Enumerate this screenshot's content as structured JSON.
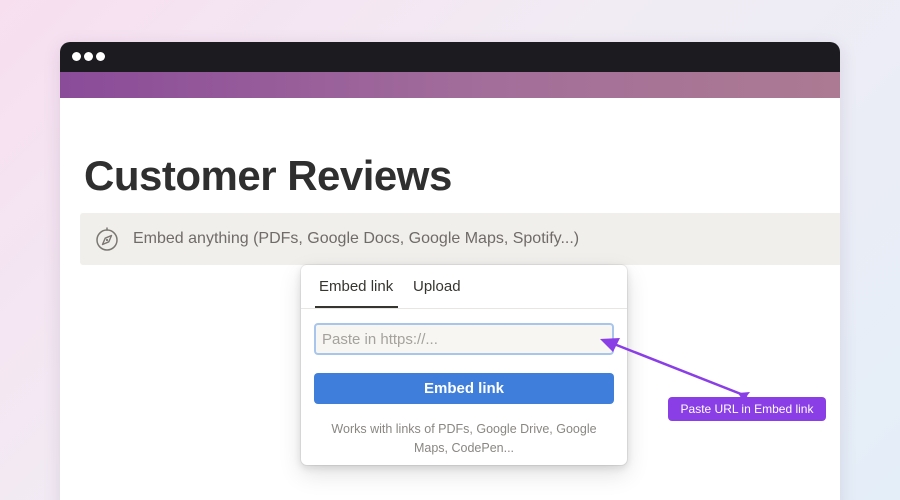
{
  "window": {
    "controls": [
      "close",
      "minimize",
      "maximize"
    ]
  },
  "page": {
    "title": "Customer Reviews"
  },
  "embed_block": {
    "icon": "compass-icon",
    "text": "Embed anything (PDFs, Google Docs, Google Maps, Spotify...)"
  },
  "popover": {
    "tabs": [
      {
        "label": "Embed link",
        "active": true
      },
      {
        "label": "Upload",
        "active": false
      }
    ],
    "input": {
      "value": "",
      "placeholder": "Paste in https://..."
    },
    "button_label": "Embed link",
    "hint": "Works with links of PDFs, Google Drive, Google Maps, CodePen..."
  },
  "annotation": {
    "text": "Paste URL in Embed link"
  },
  "colors": {
    "accent_button": "#3f7fdb",
    "callout": "#8a3ee6",
    "cover_start": "#8a4b99",
    "cover_end": "#ac7a92"
  }
}
